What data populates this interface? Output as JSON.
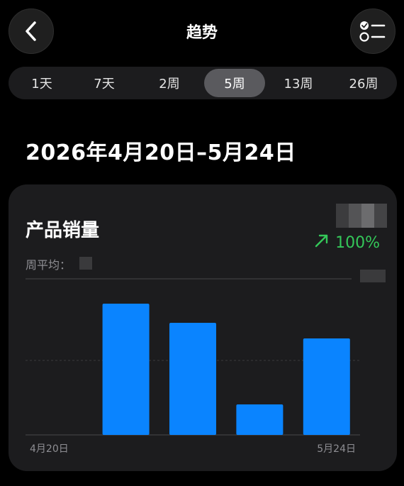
{
  "header": {
    "title": "趋势"
  },
  "range_tabs": [
    {
      "label": "1天",
      "active": false
    },
    {
      "label": "7天",
      "active": false
    },
    {
      "label": "2周",
      "active": false
    },
    {
      "label": "5周",
      "active": true
    },
    {
      "label": "13周",
      "active": false
    },
    {
      "label": "26周",
      "active": false
    }
  ],
  "date_range": "2026年4月20日–5月24日",
  "card": {
    "title": "产品销量",
    "avg_label": "周平均：",
    "trend": {
      "percent_text": "100%",
      "direction": "up",
      "color": "#34c759"
    }
  },
  "chart_data": {
    "type": "bar",
    "categories": [
      "4月20日",
      "",
      "",
      "",
      "5月24日"
    ],
    "values": [
      0,
      185,
      158,
      43,
      136
    ],
    "ylim": [
      0,
      220
    ],
    "bar_color": "#0a84ff",
    "grid": true
  },
  "colors": {
    "background": "#000000",
    "card": "#1c1c1e",
    "active_tab": "#5a5a5e",
    "accent_green": "#34c759",
    "bar_blue": "#0a84ff"
  },
  "icons": {
    "back": "chevron-left-icon",
    "menu": "checklist-icon",
    "trend": "arrow-up-right-icon"
  }
}
